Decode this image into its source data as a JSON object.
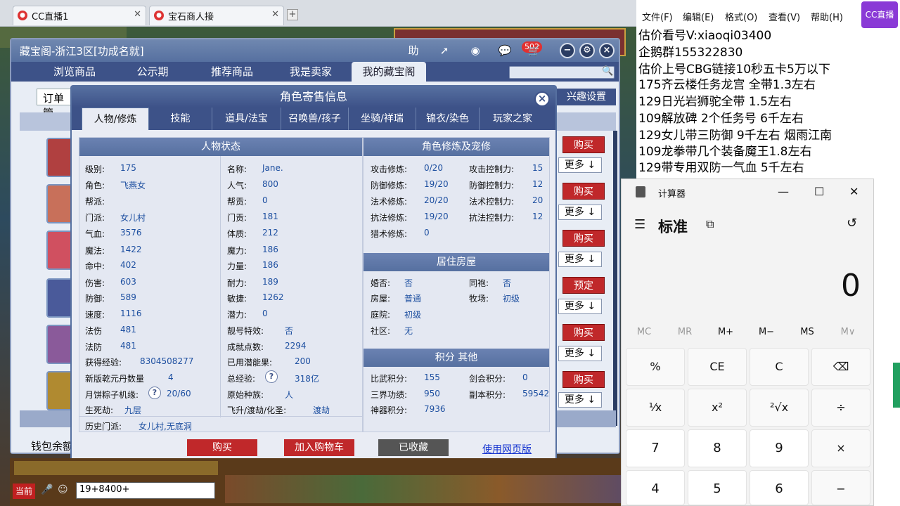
{
  "browser_tabs": [
    {
      "label": "CC直播1"
    },
    {
      "label": "宝石商人接"
    }
  ],
  "cbg": {
    "title": "藏宝阁-浙江3区[功成名就]",
    "help_label": "助",
    "cart_count": "502",
    "nav": [
      "浏览商品",
      "公示期",
      "推荐商品",
      "我是卖家",
      "我的藏宝阁"
    ],
    "order_mgr": "订单管",
    "interest": "兴趣设置",
    "wallet": "钱包余额",
    "rows": [
      {
        "action": "购买",
        "more": "更多 ↓"
      },
      {
        "action": "购买",
        "more": "更多 ↓"
      },
      {
        "action": "购买",
        "more": "更多 ↓"
      },
      {
        "action": "预定",
        "more": "更多 ↓"
      },
      {
        "action": "购买",
        "more": "更多 ↓"
      },
      {
        "action": "购买",
        "more": "更多 ↓"
      }
    ]
  },
  "dialog": {
    "title": "角色寄售信息",
    "close": "×",
    "tabs": [
      "人物/修炼",
      "技能",
      "道具/法宝",
      "召唤兽/孩子",
      "坐骑/祥瑞",
      "锦衣/染色",
      "玩家之家"
    ],
    "status_head": "人物状态",
    "status_left": [
      {
        "k": "级别:",
        "v": "175"
      },
      {
        "k": "角色:",
        "v": "飞燕女"
      },
      {
        "k": "帮派:",
        "v": ""
      },
      {
        "k": "门派:",
        "v": "女儿村"
      },
      {
        "k": "气血:",
        "v": "3576"
      },
      {
        "k": "魔法:",
        "v": "1422"
      },
      {
        "k": "命中:",
        "v": "402"
      },
      {
        "k": "伤害:",
        "v": "603"
      },
      {
        "k": "防御:",
        "v": "589"
      },
      {
        "k": "速度:",
        "v": "1116"
      },
      {
        "k": "法伤",
        "v": "481"
      },
      {
        "k": "法防",
        "v": "481"
      },
      {
        "k": "获得经验:",
        "v": "8304508277"
      },
      {
        "k": "新版乾元丹数量",
        "v": "4"
      },
      {
        "k": "月饼粽子机缘:",
        "v": "20/60"
      },
      {
        "k": "生死劫:",
        "v": "九层"
      },
      {
        "k": "历史门派:",
        "v": "女儿村,无底洞"
      }
    ],
    "status_right": [
      {
        "k": "名称:",
        "v": "Jane."
      },
      {
        "k": "人气:",
        "v": "800"
      },
      {
        "k": "帮贡:",
        "v": "0"
      },
      {
        "k": "门贡:",
        "v": "181"
      },
      {
        "k": "体质:",
        "v": "212"
      },
      {
        "k": "魔力:",
        "v": "186"
      },
      {
        "k": "力量:",
        "v": "186"
      },
      {
        "k": "耐力:",
        "v": "189"
      },
      {
        "k": "敏捷:",
        "v": "1262"
      },
      {
        "k": "潜力:",
        "v": "0"
      },
      {
        "k": "靓号特效:",
        "v": "否"
      },
      {
        "k": "成就点数:",
        "v": "2294"
      },
      {
        "k": "已用潜能果:",
        "v": "200"
      },
      {
        "k": "总经验:",
        "v": "318亿"
      },
      {
        "k": "原始种族:",
        "v": "人"
      },
      {
        "k": "飞升/渡劫/化圣:",
        "v": "渡劫"
      }
    ],
    "q_mark": "?",
    "cult_head": "角色修炼及宠修",
    "cult": [
      {
        "k": "攻击修炼:",
        "v": "0/20",
        "k2": "攻击控制力:",
        "v2": "15"
      },
      {
        "k": "防御修炼:",
        "v": "19/20",
        "k2": "防御控制力:",
        "v2": "12"
      },
      {
        "k": "法术修炼:",
        "v": "20/20",
        "k2": "法术控制力:",
        "v2": "20"
      },
      {
        "k": "抗法修炼:",
        "v": "19/20",
        "k2": "抗法控制力:",
        "v2": "12"
      },
      {
        "k": "猎术修炼:",
        "v": "0",
        "k2": "",
        "v2": ""
      }
    ],
    "house_head": "居住房屋",
    "house": [
      {
        "k": "婚否:",
        "v": "否",
        "k2": "同袍:",
        "v2": "否"
      },
      {
        "k": "房屋:",
        "v": "普通",
        "k2": "牧场:",
        "v2": "初级"
      },
      {
        "k": "庭院:",
        "v": "初级",
        "k2": "",
        "v2": ""
      },
      {
        "k": "社区:",
        "v": "无",
        "k2": "",
        "v2": ""
      }
    ],
    "score_head": "积分 其他",
    "score": [
      {
        "k": "比武积分:",
        "v": "155",
        "k2": "剑会积分:",
        "v2": "0"
      },
      {
        "k": "三界功绩:",
        "v": "950",
        "k2": "副本积分:",
        "v2": "59542"
      },
      {
        "k": "神器积分:",
        "v": "7936",
        "k2": "",
        "v2": ""
      }
    ],
    "buy": "购买",
    "cart": "加入购物车",
    "fav": "已收藏",
    "web": "使用网页版"
  },
  "game": {
    "channel": "当前",
    "chat_value": "19+8400+"
  },
  "notepad": {
    "menu": [
      "文件(F)",
      "编辑(E)",
      "格式(O)",
      "查看(V)",
      "帮助(H)"
    ],
    "logo": "CC直播",
    "lines": [
      "估价看号V:xiaoqi03400",
      "企鹅群155322830",
      "估价上号CBG链接10秒五卡5万以下",
      "175齐云楼任务龙宫  全带1.3左右",
      "129日光岩狮驼全带  1.5左右",
      "109解放碑 2个任务号 6千左右",
      "129女儿带三防御 9千左右 烟雨江南",
      "109龙拳带几个装备魔王1.8左右",
      "129带专用双防一气血 5千左右"
    ]
  },
  "calculator": {
    "title": "计算器",
    "mode": "标准",
    "display": "0",
    "memory": [
      "MC",
      "MR",
      "M+",
      "M−",
      "MS",
      "M∨"
    ],
    "keys": [
      [
        "%",
        "CE",
        "C",
        "⌫"
      ],
      [
        "¹⁄x",
        "x²",
        "²√x",
        "÷"
      ],
      [
        "7",
        "8",
        "9",
        "×"
      ],
      [
        "4",
        "5",
        "6",
        "−"
      ]
    ]
  }
}
